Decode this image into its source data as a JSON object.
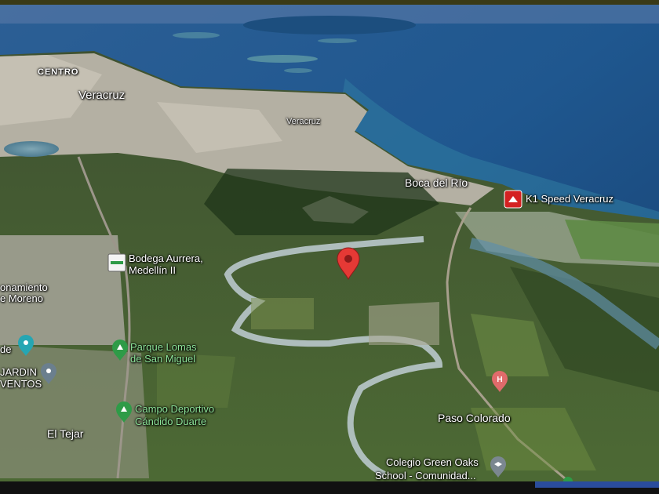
{
  "map": {
    "places": {
      "centro": "CENTRO",
      "veracruz_city": "Veracruz",
      "veracruz_small": "Veracruz",
      "boca_del_rio": "Boca del Río",
      "el_tejar": "El Tejar",
      "paso_colorado": "Paso Colorado",
      "fraccionamiento_line1": "onamiento",
      "fraccionamiento_line2": "e Moreno",
      "road_left": "de"
    },
    "pois": {
      "k1_speed": "K1 Speed Veracruz",
      "bodega_line1": "Bodega Aurrera,",
      "bodega_line2": "Medellín II",
      "parque_line1": "Parque Lomas",
      "parque_line2": "de San Miguel",
      "campo_line1": "Campo Deportivo",
      "campo_line2": "Cándido Duarte",
      "jardin_line1": "JARDIN",
      "jardin_line2": "VENTOS",
      "colegio_line1": "Colegio Green Oaks",
      "colegio_line2": "School - Comunidad..."
    },
    "icons": {
      "selected_pin": "red-location-pin-icon",
      "k1_icon": "racing-icon",
      "bodega_icon": "store-icon",
      "park_icon": "park-icon",
      "hospital_icon": "hospital-icon",
      "school_icon": "school-icon"
    },
    "colors": {
      "ocean": "#1d4f86",
      "urban": "#b9b4a6",
      "vegetation": "#3c5a2c",
      "pin_red": "#e53935",
      "poi_green": "#2e9b47"
    }
  }
}
